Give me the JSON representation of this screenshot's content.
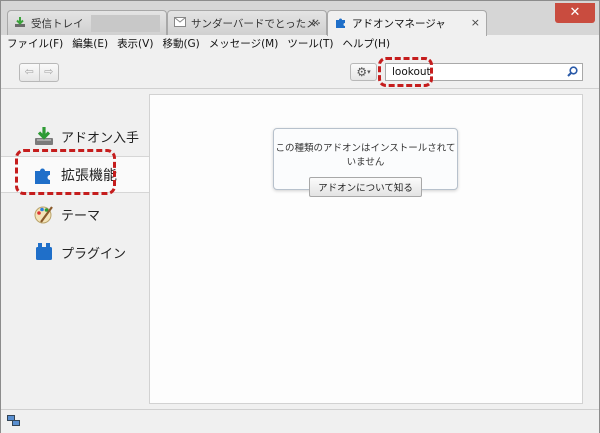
{
  "tabs": [
    {
      "label": "受信トレイ -",
      "icon": "download-icon",
      "redacted": true
    },
    {
      "label": "サンダーバードでとったメール ...",
      "icon": "mail-icon"
    },
    {
      "label": "アドオンマネージャ",
      "icon": "puzzle-icon",
      "active": true
    }
  ],
  "tab_close_glyph": "×",
  "window_close_glyph": "✕",
  "menubar": [
    "ファイル(F)",
    "編集(E)",
    "表示(V)",
    "移動(G)",
    "メッセージ(M)",
    "ツール(T)",
    "ヘルプ(H)"
  ],
  "toolbar": {
    "back_glyph": "⇦",
    "forward_glyph": "⇨",
    "gear_glyph": "⚙",
    "dropdown_glyph": "▾",
    "search_value": "lookout"
  },
  "categories": [
    {
      "label": "アドオン入手",
      "icon": "get-addons-icon"
    },
    {
      "label": "拡張機能",
      "icon": "extensions-puzzle-icon",
      "selected": true
    },
    {
      "label": "テーマ",
      "icon": "themes-brush-icon"
    },
    {
      "label": "プラグイン",
      "icon": "plugins-block-icon"
    }
  ],
  "notice": {
    "message": "この種類のアドオンはインストールされていません",
    "button": "アドオンについて知る"
  },
  "colors": {
    "highlight": "#c51d1d",
    "puzzle_blue": "#1f6fc9",
    "window_close": "#c94c3f"
  }
}
